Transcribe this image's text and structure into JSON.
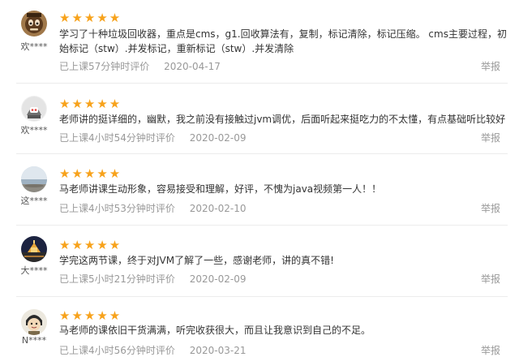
{
  "colors": {
    "star": "#f7a21b",
    "meta_text": "#999999",
    "body_text": "#333333",
    "divider": "#ececec"
  },
  "reviews": [
    {
      "avatar_icon": "cartoon-character-avatar",
      "username": "欢****",
      "rating": 5,
      "stars": "★★★★★",
      "text": "学习了十种垃圾回收器，重点是cms，g1.回收算法有，复制，标记清除，标记压缩。 cms主要过程，初始标记（stw）.并发标记，重新标记（stw）.并发清除",
      "watched": "已上课57分钟时评价",
      "date": "2020-04-17",
      "report": "举报"
    },
    {
      "avatar_icon": "robot-avatar",
      "username": "欢****",
      "rating": 5,
      "stars": "★★★★★",
      "text": "老师讲的挺详细的，幽默，我之前没有接触过jvm调优，后面听起来挺吃力的不太懂，有点基础听比较好",
      "watched": "已上课4小时54分钟时评价",
      "date": "2020-02-09",
      "report": "举报"
    },
    {
      "avatar_icon": "seaside-landscape-avatar",
      "username": "这****",
      "rating": 5,
      "stars": "★★★★★",
      "text": "马老师讲课生动形象，容易接受和理解，好评，不愧为java视频第一人！！",
      "watched": "已上课4小时53分钟时评价",
      "date": "2020-02-10",
      "report": "举报"
    },
    {
      "avatar_icon": "night-temple-avatar",
      "username": "大****",
      "rating": 5,
      "stars": "★★★★★",
      "text": "学完这两节课，终于对JVM了解了一些，感谢老师，讲的真不错!",
      "watched": "已上课5小时21分钟时评价",
      "date": "2020-02-09",
      "report": "举报"
    },
    {
      "avatar_icon": "anime-character-avatar",
      "username": "N****",
      "rating": 5,
      "stars": "★★★★★",
      "text": "马老师的课依旧干货满满，听完收获很大，而且让我意识到自己的不足。",
      "watched": "已上课4小时56分钟时评价",
      "date": "2020-03-21",
      "report": "举报"
    }
  ]
}
